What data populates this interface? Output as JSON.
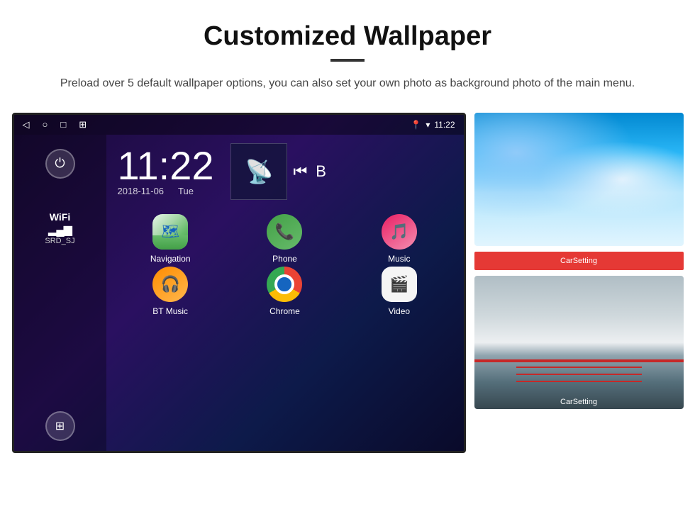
{
  "page": {
    "title": "Customized Wallpaper",
    "subtitle": "Preload over 5 default wallpaper options, you can also set your own photo as background photo of the main menu."
  },
  "android": {
    "status_bar": {
      "time": "11:22",
      "nav_back": "◁",
      "nav_home": "○",
      "nav_square": "□",
      "nav_photo": "⊡",
      "location_icon": "♦",
      "wifi_icon": "▾",
      "time_label": "11:22"
    },
    "clock": {
      "time": "11:22",
      "date": "2018-11-06",
      "day": "Tue"
    },
    "wifi": {
      "label": "WiFi",
      "name": "SRD_SJ"
    },
    "apps": [
      {
        "id": "navigation",
        "label": "Navigation",
        "type": "nav"
      },
      {
        "id": "phone",
        "label": "Phone",
        "type": "phone"
      },
      {
        "id": "music",
        "label": "Music",
        "type": "music"
      },
      {
        "id": "bt-music",
        "label": "BT Music",
        "type": "bt"
      },
      {
        "id": "chrome",
        "label": "Chrome",
        "type": "chrome"
      },
      {
        "id": "video",
        "label": "Video",
        "type": "video"
      }
    ],
    "car_setting_label": "CarSetting"
  },
  "wallpapers": {
    "thumb1_alt": "Ice/glacier blue wallpaper",
    "thumb2_alt": "Golden Gate Bridge wallpaper",
    "car_setting": "CarSetting"
  }
}
